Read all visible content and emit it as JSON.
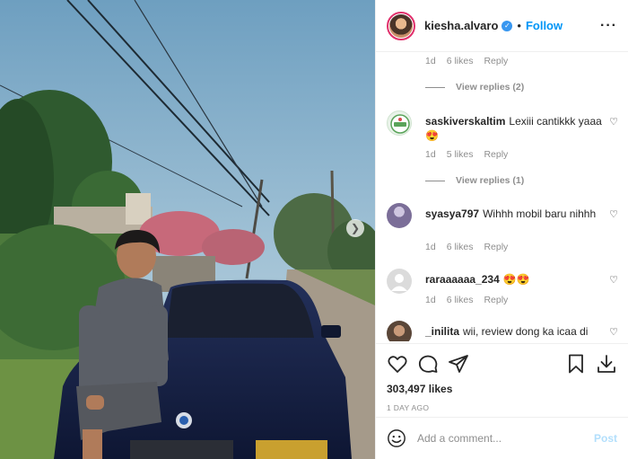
{
  "post": {
    "username": "kiesha.alvaro",
    "follow_label": "Follow",
    "dot": "•",
    "more": "···",
    "likes": "303,497 likes",
    "date": "1 DAY AGO"
  },
  "comments_top": {
    "time": "1d",
    "likes": "6 likes",
    "reply": "Reply",
    "view_replies": "View replies (2)"
  },
  "comments": [
    {
      "username": "saskiverskaltim",
      "text": "Lexiii cantikkk yaaa 😍",
      "time": "1d",
      "likes": "5 likes",
      "reply": "Reply",
      "view_replies": "View replies (1)",
      "avatar_color": "#e9f3e9"
    },
    {
      "username": "syasya797",
      "text": "Wihhh mobil baru nihhh",
      "time": "1d",
      "likes": "6 likes",
      "reply": "Reply",
      "avatar_color": "#7b6e98"
    },
    {
      "username": "raraaaaaa_234",
      "text": "😍😍",
      "time": "1d",
      "likes": "6 likes",
      "reply": "Reply",
      "avatar_color": "#dbdbdb"
    },
    {
      "username": "_inilita",
      "text": "wii, review dong ka icaa di",
      "avatar_color": "#5a4638"
    }
  ],
  "comment_box": {
    "placeholder": "Add a comment...",
    "post_label": "Post"
  },
  "icons": {
    "more": "more-options-icon",
    "heart": "heart-icon",
    "comment": "comment-icon",
    "share": "share-icon",
    "save": "bookmark-icon",
    "download": "download-icon",
    "emoji": "emoji-icon",
    "next": "chevron-right-icon"
  },
  "colors": {
    "accent": "#0095f6",
    "muted": "#8e8e8e",
    "border": "#efefef"
  }
}
